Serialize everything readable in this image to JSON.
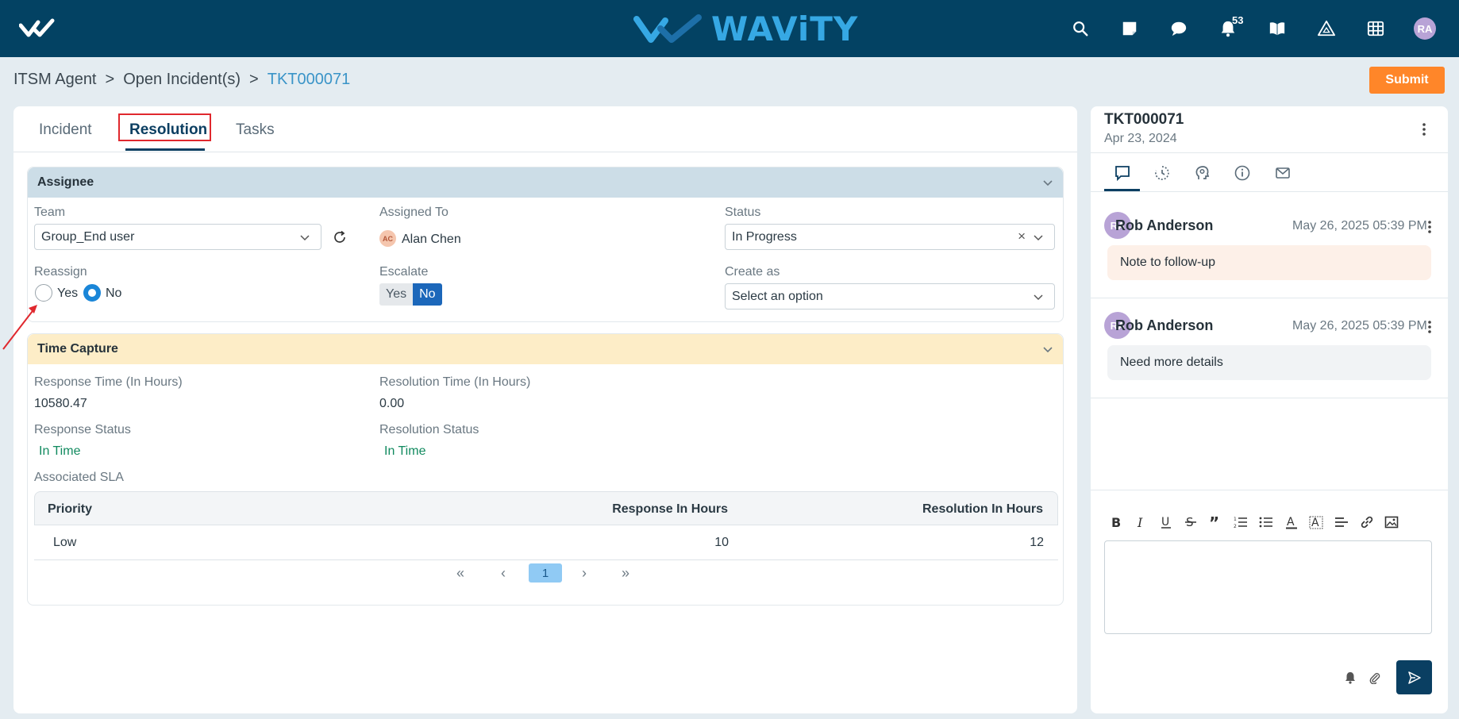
{
  "brand": {
    "name": "WAViTY",
    "accent": "#36a8e4",
    "topbar_color": "#034263"
  },
  "topbar": {
    "icons": [
      "search-icon",
      "note-icon",
      "chat-icon",
      "bell-icon",
      "book-icon",
      "warning-icon",
      "grid-icon"
    ],
    "notification_count": "53",
    "user_initials": "RA"
  },
  "breadcrumb": {
    "items": [
      "ITSM Agent",
      ">",
      "Open Incident(s)",
      ">",
      "TKT000071"
    ]
  },
  "actions": {
    "submit_label": "Submit",
    "submit_color": "#ff8629"
  },
  "tabs": {
    "incident": "Incident",
    "resolution": "Resolution",
    "tasks": "Tasks",
    "active": "Resolution"
  },
  "assignee": {
    "title": "Assignee",
    "team_label": "Team",
    "team_value": "Group_End user",
    "assigned_to_label": "Assigned To",
    "assigned_initials": "AC",
    "assigned_name": "Alan Chen",
    "status_label": "Status",
    "status_value": "In Progress",
    "reassign_label": "Reassign",
    "reassign_yes": "Yes",
    "reassign_no": "No",
    "reassign_selected": "No",
    "escalate_label": "Escalate",
    "escalate_yes": "Yes",
    "escalate_no": "No",
    "escalate_selected": "No",
    "create_as_label": "Create as",
    "create_as_placeholder": "Select an option"
  },
  "time_capture": {
    "title": "Time Capture",
    "response_time_label": "Response Time (In Hours)",
    "response_time_value": "10580.47",
    "resolution_time_label": "Resolution Time (In Hours)",
    "resolution_time_value": "0.00",
    "response_status_label": "Response Status",
    "response_status_value": "In Time",
    "resolution_status_label": "Resolution Status",
    "resolution_status_value": "In Time",
    "sla_label": "Associated SLA",
    "sla_columns": [
      "Priority",
      "Response In Hours",
      "Resolution In Hours"
    ],
    "sla_rows": [
      [
        "Low",
        "10",
        "12"
      ]
    ],
    "pager": {
      "first": "«",
      "prev": "‹",
      "current": "1",
      "next": "›",
      "last": "»"
    }
  },
  "side": {
    "ticket_id": "TKT000071",
    "ticket_date": "Apr 23, 2024",
    "tabs": [
      "comment-icon",
      "history-icon",
      "support-icon",
      "info-icon",
      "mail-icon"
    ],
    "comments": [
      {
        "initials": "RA",
        "author": "Rob Anderson",
        "time": "May 26, 2025 05:39 PM",
        "text": "Note to follow-up",
        "bubble_color": "#fdf0e8"
      },
      {
        "initials": "RA",
        "author": "Rob Anderson",
        "time": "May 26, 2025 05:39 PM",
        "text": "Need more details",
        "bubble_color": "#f1f3f5"
      }
    ]
  }
}
